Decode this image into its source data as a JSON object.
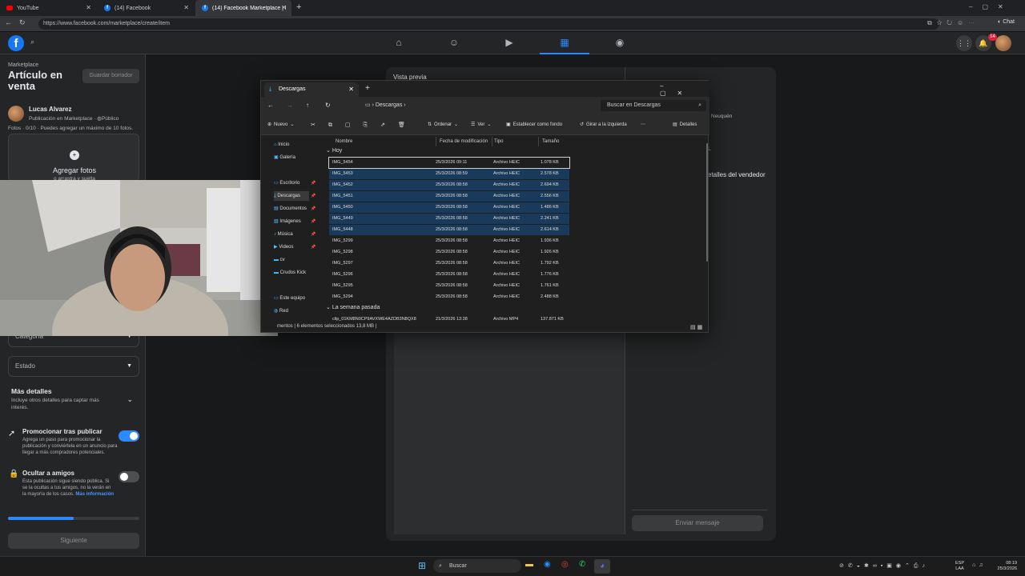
{
  "browser": {
    "tabs": [
      {
        "title": "YouTube",
        "favicon": "youtube-icon"
      },
      {
        "title": "(14) Facebook",
        "favicon": "facebook-icon"
      },
      {
        "title": "(14) Facebook Marketplace | Faceb",
        "favicon": "facebook-icon"
      }
    ],
    "url": "https://www.facebook.com/marketplace/create/item",
    "chat_label": "Chat"
  },
  "fb_header": {
    "notif_count": "14"
  },
  "left_panel": {
    "section": "Marketplace",
    "title": "Artículo en venta",
    "draft_button": "Guardar borrador",
    "user_name": "Lucas Alvarez",
    "user_meta": "Publicación en Marketplace · ",
    "privacy": "Público",
    "photos_info": "Fotos · 0/10 · Puedes agregar un máximo de 10 fotos.",
    "add_photos": "Agregar fotos",
    "drag_hint": "o arrastra y suelta",
    "category_placeholder": "Categoría",
    "state_placeholder": "Estado",
    "more_details_title": "Más detalles",
    "more_details_desc": "Incluye otros detalles para captar más interés.",
    "promote_title": "Promocionar tras publicar",
    "promote_desc": "Agrega un paso para promocionar la publicación y conviértela en un anuncio para llegar a más compradores potenciales.",
    "hide_title": "Ocultar a amigos",
    "hide_desc": "Esta publicación sigue siendo pública. Si se la ocultas a tus amigos, no la verán en la mayoría de los casos.",
    "more_info": "Más información",
    "progress": 0.5,
    "next_button": "Siguiente",
    "promote_on": true,
    "hide_on": false
  },
  "preview": {
    "title": "Vista previa",
    "location": "Neuquén",
    "seller_details": "etalles del vendedor",
    "send_button": "Enviar mensaje"
  },
  "explorer": {
    "tab_title": "Descargas",
    "path": "Descargas",
    "search_placeholder": "Buscar en Descargas",
    "toolbar": {
      "new": "Nuevo",
      "sort": "Ordenar",
      "view": "Ver",
      "set_bg": "Establecer como fondo",
      "rotate": "Girar a la izquierda",
      "details": "Detalles"
    },
    "nav": [
      {
        "label": "Inicio",
        "pinned": false
      },
      {
        "label": "Galería",
        "pinned": false
      },
      {
        "label": "Escritorio",
        "pinned": true
      },
      {
        "label": "Descargas",
        "pinned": true
      },
      {
        "label": "Documentos",
        "pinned": true
      },
      {
        "label": "Imágenes",
        "pinned": true
      },
      {
        "label": "Música",
        "pinned": true
      },
      {
        "label": "Videos",
        "pinned": true
      },
      {
        "label": "cv",
        "pinned": false
      },
      {
        "label": "Crudos Kick",
        "pinned": false
      },
      {
        "label": "Este equipo",
        "pinned": false
      },
      {
        "label": "Red",
        "pinned": false
      }
    ],
    "columns": [
      "Nombre",
      "Fecha de modificación",
      "Tipo",
      "Tamaño"
    ],
    "group_today": "Hoy",
    "group_last_week": "La semana pasada",
    "files": [
      {
        "name": "IMG_5454",
        "date": "25/3/2026 09:11",
        "type": "Archivo HEIC",
        "size": "1.078 KB",
        "selected": false,
        "focused": true
      },
      {
        "name": "IMG_5453",
        "date": "25/3/2026 08:59",
        "type": "Archivo HEIC",
        "size": "2.578 KB",
        "selected": true,
        "focused": false
      },
      {
        "name": "IMG_5452",
        "date": "25/3/2026 08:58",
        "type": "Archivo HEIC",
        "size": "2.694 KB",
        "selected": true,
        "focused": false
      },
      {
        "name": "IMG_5451",
        "date": "25/3/2026 08:58",
        "type": "Archivo HEIC",
        "size": "2.556 KB",
        "selected": true,
        "focused": false
      },
      {
        "name": "IMG_5450",
        "date": "25/3/2026 08:58",
        "type": "Archivo HEIC",
        "size": "1.486 KB",
        "selected": true,
        "focused": false
      },
      {
        "name": "IMG_5449",
        "date": "25/3/2026 08:58",
        "type": "Archivo HEIC",
        "size": "2.241 KB",
        "selected": true,
        "focused": false
      },
      {
        "name": "IMG_5448",
        "date": "25/3/2026 08:58",
        "type": "Archivo HEIC",
        "size": "2.614 KB",
        "selected": true,
        "focused": false
      },
      {
        "name": "IMG_5299",
        "date": "25/3/2026 08:58",
        "type": "Archivo HEIC",
        "size": "1.936 KB",
        "selected": false,
        "focused": false
      },
      {
        "name": "IMG_5298",
        "date": "25/3/2026 08:58",
        "type": "Archivo HEIC",
        "size": "1.926 KB",
        "selected": false,
        "focused": false
      },
      {
        "name": "IMG_5297",
        "date": "25/3/2026 08:58",
        "type": "Archivo HEIC",
        "size": "1.792 KB",
        "selected": false,
        "focused": false
      },
      {
        "name": "IMG_5296",
        "date": "25/3/2026 08:58",
        "type": "Archivo HEIC",
        "size": "1.776 KB",
        "selected": false,
        "focused": false
      },
      {
        "name": "IMG_5295",
        "date": "25/3/2026 08:58",
        "type": "Archivo HEIC",
        "size": "1.761 KB",
        "selected": false,
        "focused": false
      },
      {
        "name": "IMG_5294",
        "date": "25/3/2026 08:58",
        "type": "Archivo HEIC",
        "size": "2.488 KB",
        "selected": false,
        "focused": false
      }
    ],
    "last_week_files": [
      {
        "name": "clip_01KM8N0CP9AVXWE4AZDB3N8QX8",
        "date": "21/3/2026 13:38",
        "type": "Archivo MP4",
        "size": "137.871 KB"
      }
    ],
    "status": "mentos  |  6 elementos seleccionados  13,8 MB  |"
  },
  "taskbar": {
    "search": "Buscar",
    "lang_top": "ESP",
    "lang_bottom": "LAA",
    "time": "08:19",
    "date": "25/3/2026"
  },
  "colors": {
    "fb_blue": "#1877f2",
    "accent": "#2d88ff",
    "selection": "#1a3a5c"
  }
}
